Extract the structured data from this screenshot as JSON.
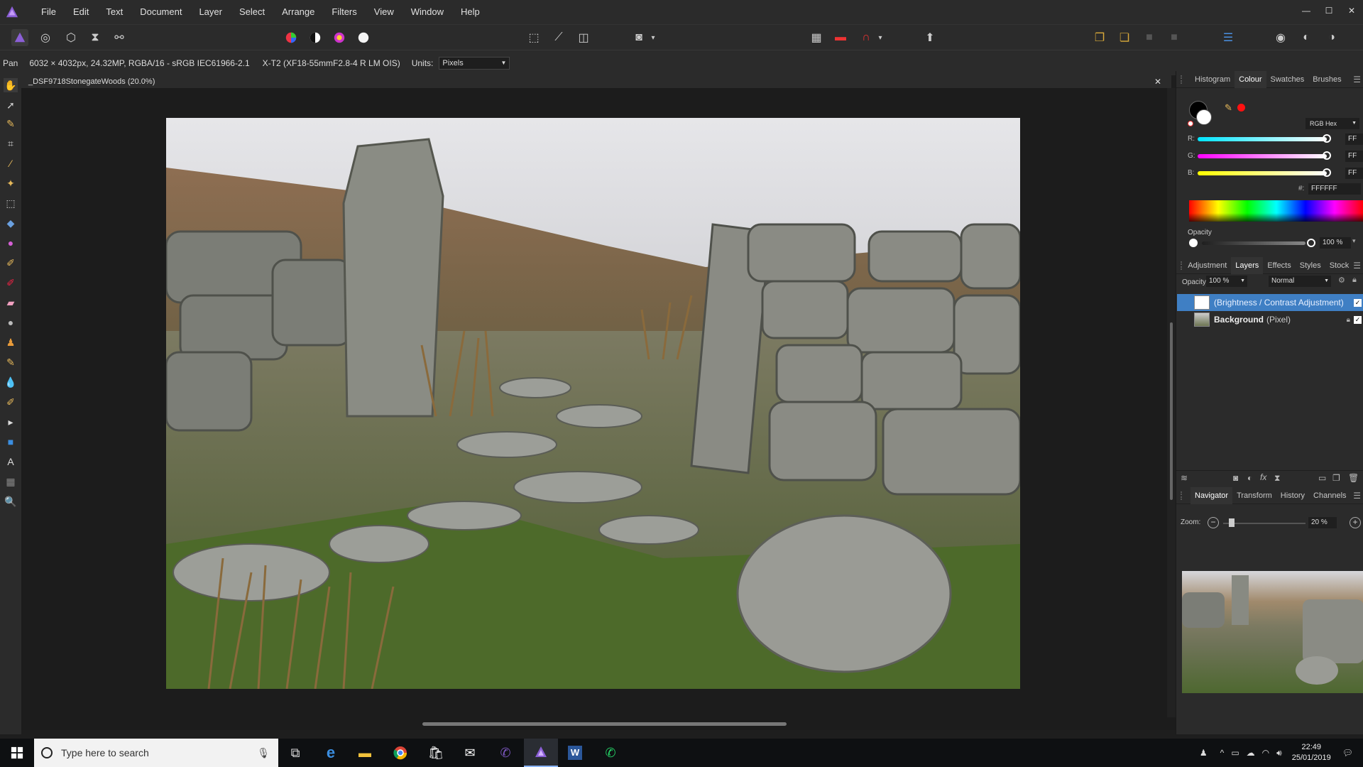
{
  "menu": [
    "File",
    "Edit",
    "Text",
    "Document",
    "Layer",
    "Select",
    "Arrange",
    "Filters",
    "View",
    "Window",
    "Help"
  ],
  "window_controls": [
    "—",
    "☐",
    "✕"
  ],
  "context": {
    "tool": "Pan",
    "image_info": "6032 × 4032px, 24.32MP, RGBA/16 - sRGB IEC61966-2.1",
    "camera": "X-T2 (XF18-55mmF2.8-4 R LM OIS)",
    "units_label": "Units:",
    "units_value": "Pixels"
  },
  "document": {
    "tab_title": "_DSF9718StonegateWoods (20.0%)",
    "close": "✕"
  },
  "colour_panel": {
    "tabs": [
      "Histogram",
      "Colour",
      "Swatches",
      "Brushes"
    ],
    "active_tab": "Colour",
    "mode": "RGB Hex",
    "channels": [
      {
        "label": "R:",
        "value": "FF",
        "color_from": "#00e5ff",
        "color_to": "#ffffff"
      },
      {
        "label": "G:",
        "value": "FF",
        "color_from": "#ff00ff",
        "color_to": "#ffffff"
      },
      {
        "label": "B:",
        "value": "FF",
        "color_from": "#ffff00",
        "color_to": "#ffffff"
      }
    ],
    "hex_label": "#:",
    "hex_value": "FFFFFF",
    "opacity_label": "Opacity",
    "opacity_value": "100 %",
    "accent_red": "#ff1111"
  },
  "layers_panel": {
    "tabs": [
      "Adjustment",
      "Layers",
      "Effects",
      "Styles",
      "Stock"
    ],
    "active_tab": "Layers",
    "opacity_label": "Opacity:",
    "opacity_value": "100 %",
    "blend_mode": "Normal",
    "layers": [
      {
        "name": "(Brightness / Contrast Adjustment)",
        "kind": "",
        "selected": true
      },
      {
        "name": "Background",
        "kind": "(Pixel)",
        "selected": false
      }
    ],
    "selection_color": "#3f7fc4"
  },
  "navigator_panel": {
    "tabs": [
      "Navigator",
      "Transform",
      "History",
      "Channels"
    ],
    "active_tab": "Navigator",
    "zoom_label": "Zoom:",
    "zoom_value": "20 %"
  },
  "taskbar": {
    "search_placeholder": "Type here to search",
    "apps": [
      "task-view",
      "edge",
      "file-explorer",
      "chrome",
      "store",
      "mail",
      "viber",
      "affinity-photo",
      "word",
      "whatsapp"
    ],
    "time": "22:49",
    "date": "25/01/2019"
  }
}
